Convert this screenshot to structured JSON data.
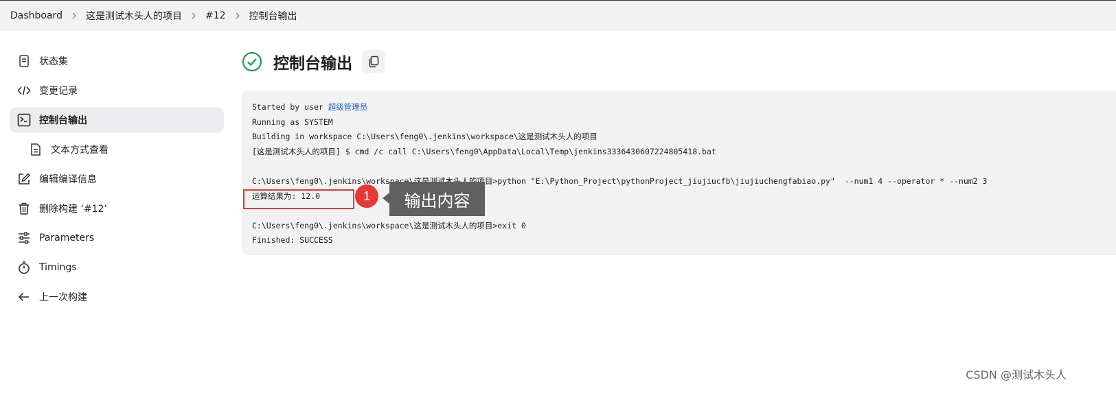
{
  "breadcrumb": {
    "items": [
      "Dashboard",
      "这是测试木头人的项目",
      "#12",
      "控制台输出"
    ]
  },
  "sidebar": {
    "items": [
      {
        "label": "状态集",
        "icon": "document-icon"
      },
      {
        "label": "变更记录",
        "icon": "code-icon"
      },
      {
        "label": "控制台输出",
        "icon": "terminal-icon",
        "active": true
      },
      {
        "label": "文本方式查看",
        "icon": "text-file-icon",
        "sub": true
      },
      {
        "label": "编辑编译信息",
        "icon": "edit-icon"
      },
      {
        "label": "删除构建 ‘#12’",
        "icon": "trash-icon"
      },
      {
        "label": "Parameters",
        "icon": "sliders-icon"
      },
      {
        "label": "Timings",
        "icon": "stopwatch-icon"
      },
      {
        "label": "上一次构建",
        "icon": "arrow-left-icon"
      }
    ]
  },
  "main": {
    "title": "控制台输出",
    "status": "success"
  },
  "console": {
    "started_prefix": "Started by user ",
    "started_user": "超级管理员",
    "lines": [
      "Running as SYSTEM",
      "Building in workspace C:\\Users\\feng0\\.jenkins\\workspace\\这是测试木头人的项目",
      "[这是测试木头人的项目] $ cmd /c call C:\\Users\\feng0\\AppData\\Local\\Temp\\jenkins3336430607224805418.bat",
      "",
      "C:\\Users\\feng0\\.jenkins\\workspace\\这是测试木头人的项目>python \"E:\\Python_Project\\pythonProject_jiujiucfb\\jiujiuchengfabiao.py\"  --num1 4 --operator * --num2 3",
      "运算结果为: 12.0",
      "",
      "C:\\Users\\feng0\\.jenkins\\workspace\\这是测试木头人的项目>exit 0",
      "Finished: SUCCESS"
    ]
  },
  "annotation": {
    "marker": "1",
    "callout": "输出内容",
    "color": "#e53935"
  },
  "watermark": "CSDN @测试木头人"
}
